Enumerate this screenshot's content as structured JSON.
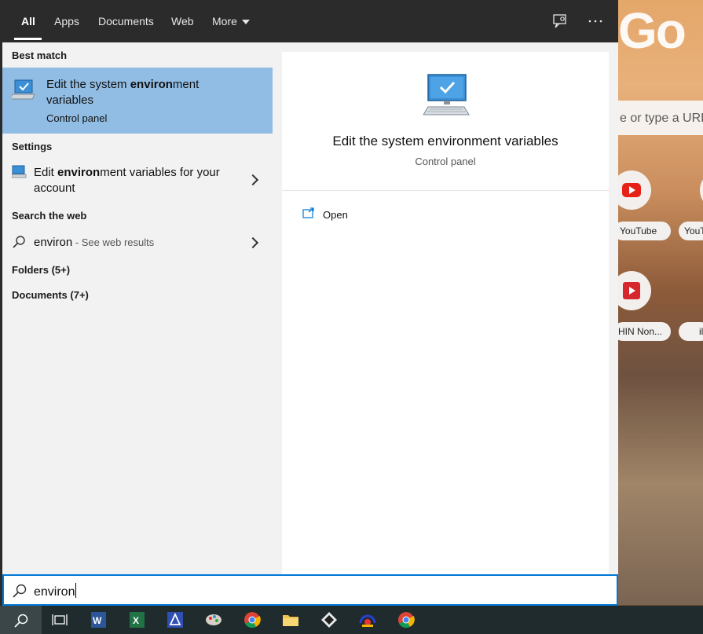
{
  "tabs": [
    {
      "label": "All",
      "active": true
    },
    {
      "label": "Apps"
    },
    {
      "label": "Documents"
    },
    {
      "label": "Web"
    },
    {
      "label": "More"
    }
  ],
  "topbar_icons": [
    "feedback-icon",
    "more-options-icon"
  ],
  "sections": {
    "best_match": "Best match",
    "settings": "Settings",
    "search_web": "Search the web",
    "folders": "Folders (5+)",
    "documents": "Documents (7+)"
  },
  "best_match": {
    "title_pre": "Edit the system ",
    "title_bold": "environ",
    "title_post": "ment variables",
    "subtitle": "Control panel",
    "icon": "computer-check-icon"
  },
  "settings_item": {
    "pre": "Edit ",
    "bold": "environ",
    "post": "ment variables for your account",
    "icon": "monitor-settings-icon"
  },
  "web_item": {
    "query": "environ",
    "suffix": " - See web results",
    "icon": "search-icon"
  },
  "preview": {
    "title": "Edit the system environment variables",
    "subtitle": "Control panel",
    "action_label": "Open"
  },
  "search_box": {
    "value": "environ"
  },
  "background_browser": {
    "logo_text": "Go",
    "search_placeholder": "e or type a URL",
    "tiles": [
      {
        "label": "YouTube",
        "icon": "youtube-icon"
      },
      {
        "label": "YouT"
      },
      {
        "label": "HIN Non...",
        "icon": "video-icon"
      },
      {
        "label": "il"
      }
    ]
  },
  "taskbar": {
    "icons": [
      "search-icon",
      "task-view-icon",
      "word-icon",
      "excel-icon",
      "app-icon",
      "paint-icon",
      "chrome-icon",
      "file-explorer-icon",
      "app-icon",
      "app-icon",
      "chrome-icon"
    ]
  },
  "colors": {
    "accent": "#0078d7",
    "selection": "#91bde4",
    "topbar": "#2b2b2b",
    "taskbar": "#1f2b2c"
  }
}
